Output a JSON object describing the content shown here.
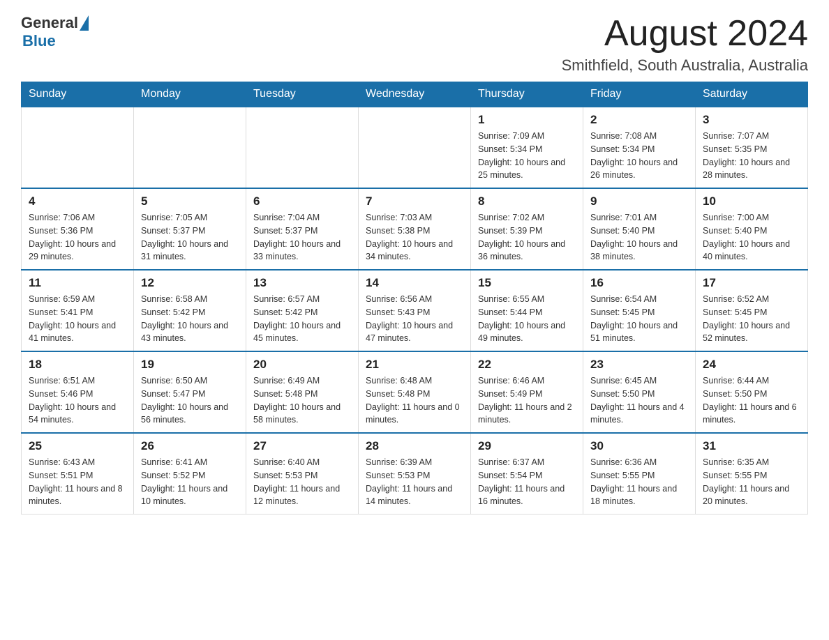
{
  "logo": {
    "general": "General",
    "blue": "Blue"
  },
  "title": "August 2024",
  "subtitle": "Smithfield, South Australia, Australia",
  "days_of_week": [
    "Sunday",
    "Monday",
    "Tuesday",
    "Wednesday",
    "Thursday",
    "Friday",
    "Saturday"
  ],
  "weeks": [
    [
      {
        "day": "",
        "info": ""
      },
      {
        "day": "",
        "info": ""
      },
      {
        "day": "",
        "info": ""
      },
      {
        "day": "",
        "info": ""
      },
      {
        "day": "1",
        "info": "Sunrise: 7:09 AM\nSunset: 5:34 PM\nDaylight: 10 hours and 25 minutes."
      },
      {
        "day": "2",
        "info": "Sunrise: 7:08 AM\nSunset: 5:34 PM\nDaylight: 10 hours and 26 minutes."
      },
      {
        "day": "3",
        "info": "Sunrise: 7:07 AM\nSunset: 5:35 PM\nDaylight: 10 hours and 28 minutes."
      }
    ],
    [
      {
        "day": "4",
        "info": "Sunrise: 7:06 AM\nSunset: 5:36 PM\nDaylight: 10 hours and 29 minutes."
      },
      {
        "day": "5",
        "info": "Sunrise: 7:05 AM\nSunset: 5:37 PM\nDaylight: 10 hours and 31 minutes."
      },
      {
        "day": "6",
        "info": "Sunrise: 7:04 AM\nSunset: 5:37 PM\nDaylight: 10 hours and 33 minutes."
      },
      {
        "day": "7",
        "info": "Sunrise: 7:03 AM\nSunset: 5:38 PM\nDaylight: 10 hours and 34 minutes."
      },
      {
        "day": "8",
        "info": "Sunrise: 7:02 AM\nSunset: 5:39 PM\nDaylight: 10 hours and 36 minutes."
      },
      {
        "day": "9",
        "info": "Sunrise: 7:01 AM\nSunset: 5:40 PM\nDaylight: 10 hours and 38 minutes."
      },
      {
        "day": "10",
        "info": "Sunrise: 7:00 AM\nSunset: 5:40 PM\nDaylight: 10 hours and 40 minutes."
      }
    ],
    [
      {
        "day": "11",
        "info": "Sunrise: 6:59 AM\nSunset: 5:41 PM\nDaylight: 10 hours and 41 minutes."
      },
      {
        "day": "12",
        "info": "Sunrise: 6:58 AM\nSunset: 5:42 PM\nDaylight: 10 hours and 43 minutes."
      },
      {
        "day": "13",
        "info": "Sunrise: 6:57 AM\nSunset: 5:42 PM\nDaylight: 10 hours and 45 minutes."
      },
      {
        "day": "14",
        "info": "Sunrise: 6:56 AM\nSunset: 5:43 PM\nDaylight: 10 hours and 47 minutes."
      },
      {
        "day": "15",
        "info": "Sunrise: 6:55 AM\nSunset: 5:44 PM\nDaylight: 10 hours and 49 minutes."
      },
      {
        "day": "16",
        "info": "Sunrise: 6:54 AM\nSunset: 5:45 PM\nDaylight: 10 hours and 51 minutes."
      },
      {
        "day": "17",
        "info": "Sunrise: 6:52 AM\nSunset: 5:45 PM\nDaylight: 10 hours and 52 minutes."
      }
    ],
    [
      {
        "day": "18",
        "info": "Sunrise: 6:51 AM\nSunset: 5:46 PM\nDaylight: 10 hours and 54 minutes."
      },
      {
        "day": "19",
        "info": "Sunrise: 6:50 AM\nSunset: 5:47 PM\nDaylight: 10 hours and 56 minutes."
      },
      {
        "day": "20",
        "info": "Sunrise: 6:49 AM\nSunset: 5:48 PM\nDaylight: 10 hours and 58 minutes."
      },
      {
        "day": "21",
        "info": "Sunrise: 6:48 AM\nSunset: 5:48 PM\nDaylight: 11 hours and 0 minutes."
      },
      {
        "day": "22",
        "info": "Sunrise: 6:46 AM\nSunset: 5:49 PM\nDaylight: 11 hours and 2 minutes."
      },
      {
        "day": "23",
        "info": "Sunrise: 6:45 AM\nSunset: 5:50 PM\nDaylight: 11 hours and 4 minutes."
      },
      {
        "day": "24",
        "info": "Sunrise: 6:44 AM\nSunset: 5:50 PM\nDaylight: 11 hours and 6 minutes."
      }
    ],
    [
      {
        "day": "25",
        "info": "Sunrise: 6:43 AM\nSunset: 5:51 PM\nDaylight: 11 hours and 8 minutes."
      },
      {
        "day": "26",
        "info": "Sunrise: 6:41 AM\nSunset: 5:52 PM\nDaylight: 11 hours and 10 minutes."
      },
      {
        "day": "27",
        "info": "Sunrise: 6:40 AM\nSunset: 5:53 PM\nDaylight: 11 hours and 12 minutes."
      },
      {
        "day": "28",
        "info": "Sunrise: 6:39 AM\nSunset: 5:53 PM\nDaylight: 11 hours and 14 minutes."
      },
      {
        "day": "29",
        "info": "Sunrise: 6:37 AM\nSunset: 5:54 PM\nDaylight: 11 hours and 16 minutes."
      },
      {
        "day": "30",
        "info": "Sunrise: 6:36 AM\nSunset: 5:55 PM\nDaylight: 11 hours and 18 minutes."
      },
      {
        "day": "31",
        "info": "Sunrise: 6:35 AM\nSunset: 5:55 PM\nDaylight: 11 hours and 20 minutes."
      }
    ]
  ]
}
